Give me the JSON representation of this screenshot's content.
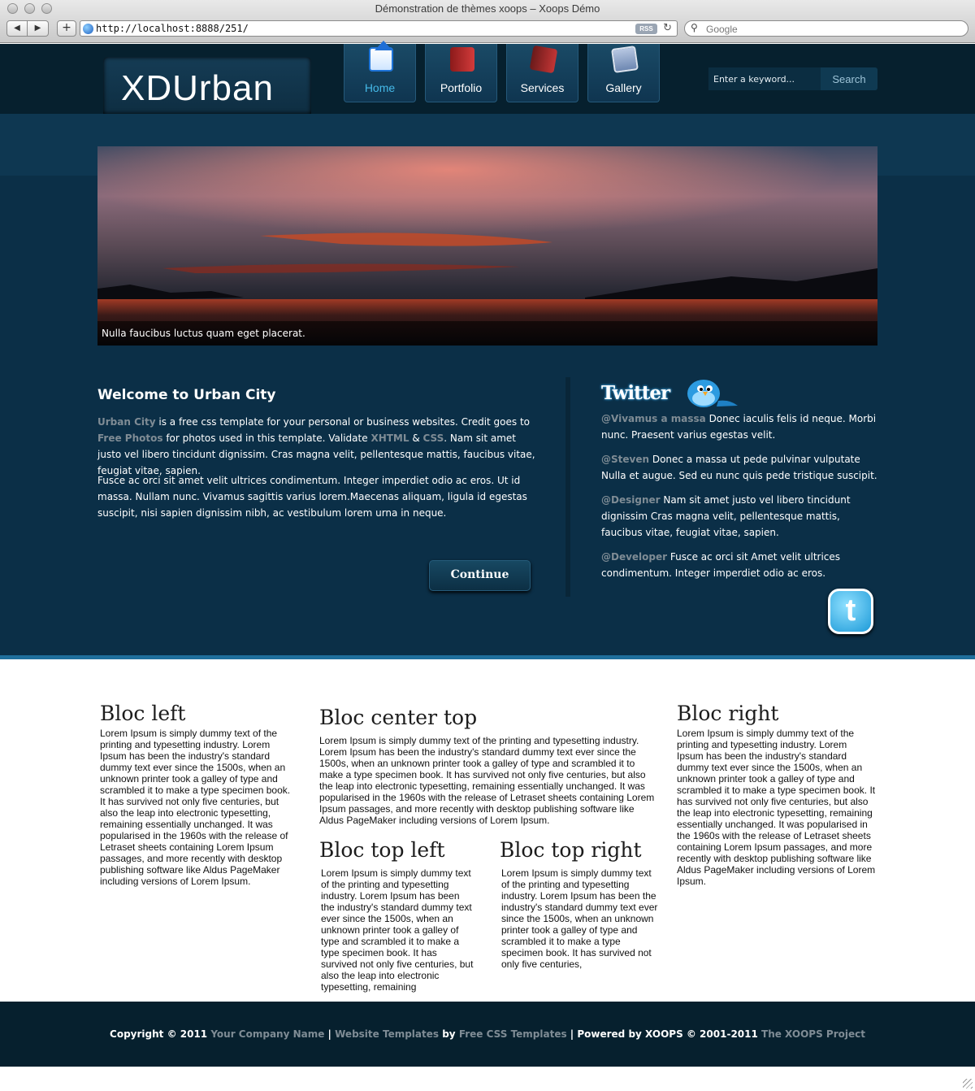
{
  "browser": {
    "window_title": "Démonstration de thèmes xoops – Xoops Démo",
    "url": "http://localhost:8888/251/",
    "rss_label": "RSS",
    "search_placeholder": "Google"
  },
  "header": {
    "logo": "XDUrban",
    "menu": [
      {
        "label": "Home",
        "icon": "home-icon",
        "active": true
      },
      {
        "label": "Portfolio",
        "icon": "portfolio-icon",
        "active": false
      },
      {
        "label": "Services",
        "icon": "book-icon",
        "active": false
      },
      {
        "label": "Gallery",
        "icon": "gallery-icon",
        "active": false
      }
    ],
    "search": {
      "placeholder": "Enter a keyword...",
      "button": "Search"
    }
  },
  "hero": {
    "caption": "Nulla faucibus luctus quam eget placerat."
  },
  "welcome": {
    "title": "Welcome to Urban City",
    "p1": {
      "link1": "Urban City",
      "t1": " is a free css template for your personal or business websites. Credit goes to ",
      "link2": "Free Photos",
      "t2": " for photos used in this template. Validate ",
      "link3": "XHTML",
      "t3": " & ",
      "link4": "CSS",
      "t4": ". Nam sit amet justo vel libero tincidunt dignissim. Cras magna velit, pellentesque mattis, faucibus vitae, feugiat vitae, sapien."
    },
    "p2": "Fusce ac orci sit amet velit ultrices condimentum. Integer imperdiet odio ac eros. Ut id massa. Nullam nunc. Vivamus sagittis varius lorem.Maecenas aliquam, ligula id egestas suscipit, nisi sapien dignissim nibh, ac vestibulum lorem urna in neque.",
    "continue_label": "Continue"
  },
  "twitter": {
    "logo_text": "Twitter",
    "badge": "t",
    "tweets": [
      {
        "handle": "@Vivamus a massa",
        "text": " Donec iaculis felis id neque. Morbi nunc. Praesent varius egestas velit."
      },
      {
        "handle": "@Steven",
        "text": " Donec a massa ut pede pulvinar vulputate Nulla et augue. Sed eu nunc quis pede tristique suscipit."
      },
      {
        "handle": "@Designer",
        "text": " Nam sit amet justo vel libero tincidunt dignissim Cras magna velit, pellentesque mattis, faucibus vitae, feugiat vitae, sapien."
      },
      {
        "handle": "@Developer",
        "text": " Fusce ac orci sit Amet velit ultrices condimentum. Integer imperdiet odio ac eros."
      }
    ]
  },
  "blocks": {
    "left": {
      "title": "Bloc left",
      "text": "Lorem Ipsum is simply dummy text of the printing and typesetting industry. Lorem Ipsum has been the industry's standard dummy text ever since the 1500s, when an unknown printer took a galley of type and scrambled it to make a type specimen book. It has survived not only five centuries, but also the leap into electronic typesetting, remaining essentially unchanged. It was popularised in the 1960s with the release of Letraset sheets containing Lorem Ipsum passages, and more recently with desktop publishing software like Aldus PageMaker including versions of Lorem Ipsum."
    },
    "center_top": {
      "title": "Bloc center top",
      "text": "Lorem Ipsum is simply dummy text of the printing and typesetting industry. Lorem Ipsum has been the industry's standard dummy text ever since the 1500s, when an unknown printer took a galley of type and scrambled it to make a type specimen book. It has survived not only five centuries, but also the leap into electronic typesetting, remaining essentially unchanged. It was popularised in the 1960s with the release of Letraset sheets containing Lorem Ipsum passages, and more recently with desktop publishing software like Aldus PageMaker including versions of Lorem Ipsum."
    },
    "top_left": {
      "title": "Bloc top left",
      "text": "Lorem Ipsum is simply dummy text of the printing and typesetting industry. Lorem Ipsum has been the industry's standard dummy text ever since the 1500s, when an unknown printer took a galley of type and scrambled it to make a type specimen book. It has survived not only five centuries, but also the leap into electronic typesetting, remaining"
    },
    "top_right": {
      "title": "Bloc top right",
      "text": "Lorem Ipsum is simply dummy text of the printing and typesetting industry. Lorem Ipsum has been the industry's standard dummy text ever since the 1500s, when an unknown printer took a galley of type and scrambled it to make a type specimen book. It has survived not only five centuries,"
    },
    "right": {
      "title": "Bloc right",
      "text": "Lorem Ipsum is simply dummy text of the printing and typesetting industry. Lorem Ipsum has been the industry's standard dummy text ever since the 1500s, when an unknown printer took a galley of type and scrambled it to make a type specimen book. It has survived not only five centuries, but also the leap into electronic typesetting, remaining essentially unchanged. It was popularised in the 1960s with the release of Letraset sheets containing Lorem Ipsum passages, and more recently with desktop publishing software like Aldus PageMaker including versions of Lorem Ipsum."
    }
  },
  "footer": {
    "copyright": "Copyright © 2011 ",
    "company": "Your Company Name",
    "sep1": " | ",
    "templates": "Website Templates",
    "by": " by ",
    "freecss": "Free CSS Templates",
    "powered": " | Powered by XOOPS © 2001-2011 ",
    "xoops_project": "The XOOPS Project"
  },
  "colors": {
    "header_bg": "#06202e",
    "main_bg": "#0b2f47",
    "accent": "#45b9e8",
    "link_gray": "#7f8c95"
  }
}
